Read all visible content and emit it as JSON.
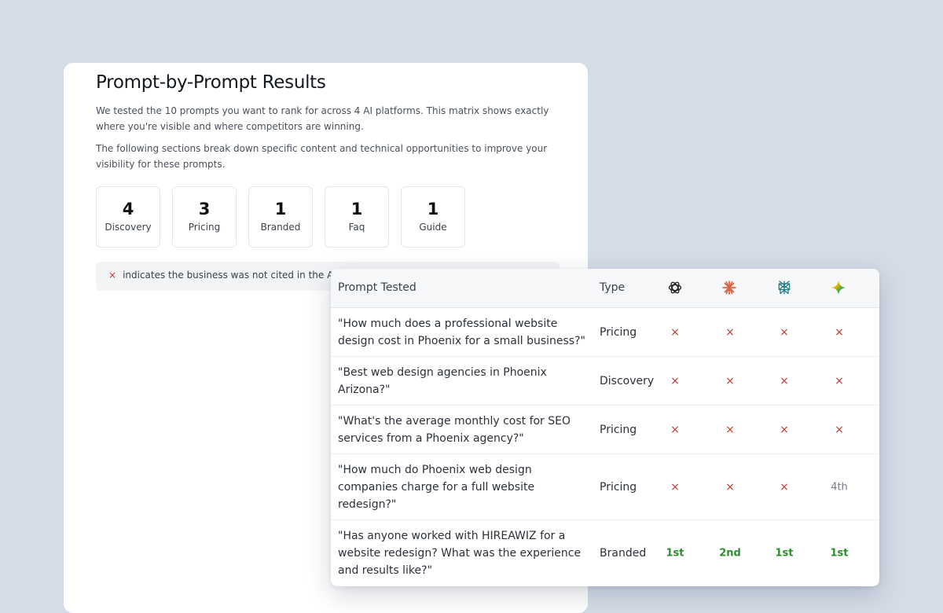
{
  "report": {
    "title": "Prompt-by-Prompt Results",
    "description_1": "We tested the 10 prompts you want to rank for across 4 AI platforms. This matrix shows exactly where you're visible and where competitors are winning.",
    "description_2": "The following sections break down specific content and technical opportunities to improve your visibility for these prompts.",
    "stats": [
      {
        "value": "4",
        "label": "Discovery"
      },
      {
        "value": "3",
        "label": "Pricing"
      },
      {
        "value": "1",
        "label": "Branded"
      },
      {
        "value": "1",
        "label": "Faq"
      },
      {
        "value": "1",
        "label": "Guide"
      }
    ],
    "legend": {
      "symbol": "×",
      "text": "indicates the business was not cited in the A"
    }
  },
  "matrix": {
    "headers": {
      "prompt": "Prompt Tested",
      "type": "Type"
    },
    "platform_icons": [
      "chatgpt-icon",
      "claude-icon",
      "perplexity-icon",
      "gemini-icon"
    ],
    "rows": [
      {
        "prompt": "\"How much does a professional website design cost in Phoenix for a small business?\"",
        "type": "Pricing",
        "results": [
          "×",
          "×",
          "×",
          "×"
        ]
      },
      {
        "prompt": "\"Best web design agencies in Phoenix Arizona?\"",
        "type": "Discovery",
        "results": [
          "×",
          "×",
          "×",
          "×"
        ]
      },
      {
        "prompt": "\"What's the average monthly cost for SEO services from a Phoenix agency?\"",
        "type": "Pricing",
        "results": [
          "×",
          "×",
          "×",
          "×"
        ]
      },
      {
        "prompt": "\"How much do Phoenix web design companies charge for a full website redesign?\"",
        "type": "Pricing",
        "results": [
          "×",
          "×",
          "×",
          "4th"
        ]
      },
      {
        "prompt": "\"Has anyone worked with HIREAWIZ for a website redesign? What was the experience and results like?\"",
        "type": "Branded",
        "results": [
          "1st",
          "2nd",
          "1st",
          "1st"
        ]
      }
    ]
  },
  "colors": {
    "background": "#d4dce7",
    "miss": "#c0392b",
    "hit": "#2e8b2e",
    "neutral": "#7a7f88"
  }
}
